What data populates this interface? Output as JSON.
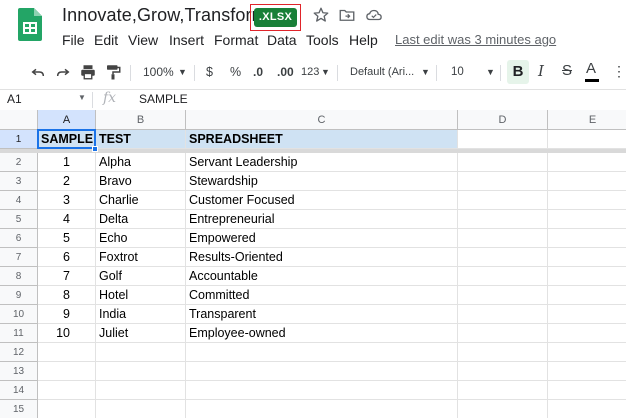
{
  "app": {
    "title": "Innovate,Grow,Transform",
    "format_badge": ".XLSX",
    "last_edit": "Last edit was 3 minutes ago",
    "icons": [
      "star-icon",
      "move-to-folder-icon",
      "cloud-status-icon"
    ]
  },
  "menu": [
    "File",
    "Edit",
    "View",
    "Insert",
    "Format",
    "Data",
    "Tools",
    "Help"
  ],
  "toolbar": {
    "zoom": "100%",
    "currency": "$",
    "percent": "%",
    "decrease_decimals": ".0",
    "increase_decimals": ".00",
    "more_formats": "123",
    "font": "Default (Ari...",
    "font_size": "10",
    "bold": "B",
    "italic": "I",
    "strikethrough": "S",
    "text_color": "A"
  },
  "formula_bar": {
    "name_box": "A1",
    "fx": "fx",
    "value": "SAMPLE"
  },
  "colors": {
    "accent": "#1a73e8",
    "header_fill": "#cfe2f3",
    "badge": "#188038",
    "badge_outline": "#e0242a"
  },
  "grid": {
    "columns": [
      "A",
      "B",
      "C",
      "D",
      "E"
    ],
    "selected_cell": "A1",
    "rows": [
      {
        "n": "1",
        "a": "SAMPLE",
        "b": "TEST",
        "c": "SPREADSHEET"
      },
      {
        "n": "2",
        "a": "1",
        "b": "Alpha",
        "c": "Servant Leadership"
      },
      {
        "n": "3",
        "a": "2",
        "b": "Bravo",
        "c": "Stewardship"
      },
      {
        "n": "4",
        "a": "3",
        "b": "Charlie",
        "c": "Customer Focused"
      },
      {
        "n": "5",
        "a": "4",
        "b": "Delta",
        "c": "Entrepreneurial"
      },
      {
        "n": "6",
        "a": "5",
        "b": "Echo",
        "c": "Empowered"
      },
      {
        "n": "7",
        "a": "6",
        "b": "Foxtrot",
        "c": "Results-Oriented"
      },
      {
        "n": "8",
        "a": "7",
        "b": "Golf",
        "c": "Accountable"
      },
      {
        "n": "9",
        "a": "8",
        "b": "Hotel",
        "c": "Committed"
      },
      {
        "n": "10",
        "a": "9",
        "b": "India",
        "c": "Transparent"
      },
      {
        "n": "11",
        "a": "10",
        "b": "Juliet",
        "c": "Employee-owned"
      },
      {
        "n": "12",
        "a": "",
        "b": "",
        "c": ""
      },
      {
        "n": "13",
        "a": "",
        "b": "",
        "c": ""
      },
      {
        "n": "14",
        "a": "",
        "b": "",
        "c": ""
      },
      {
        "n": "15",
        "a": "",
        "b": "",
        "c": ""
      }
    ]
  }
}
